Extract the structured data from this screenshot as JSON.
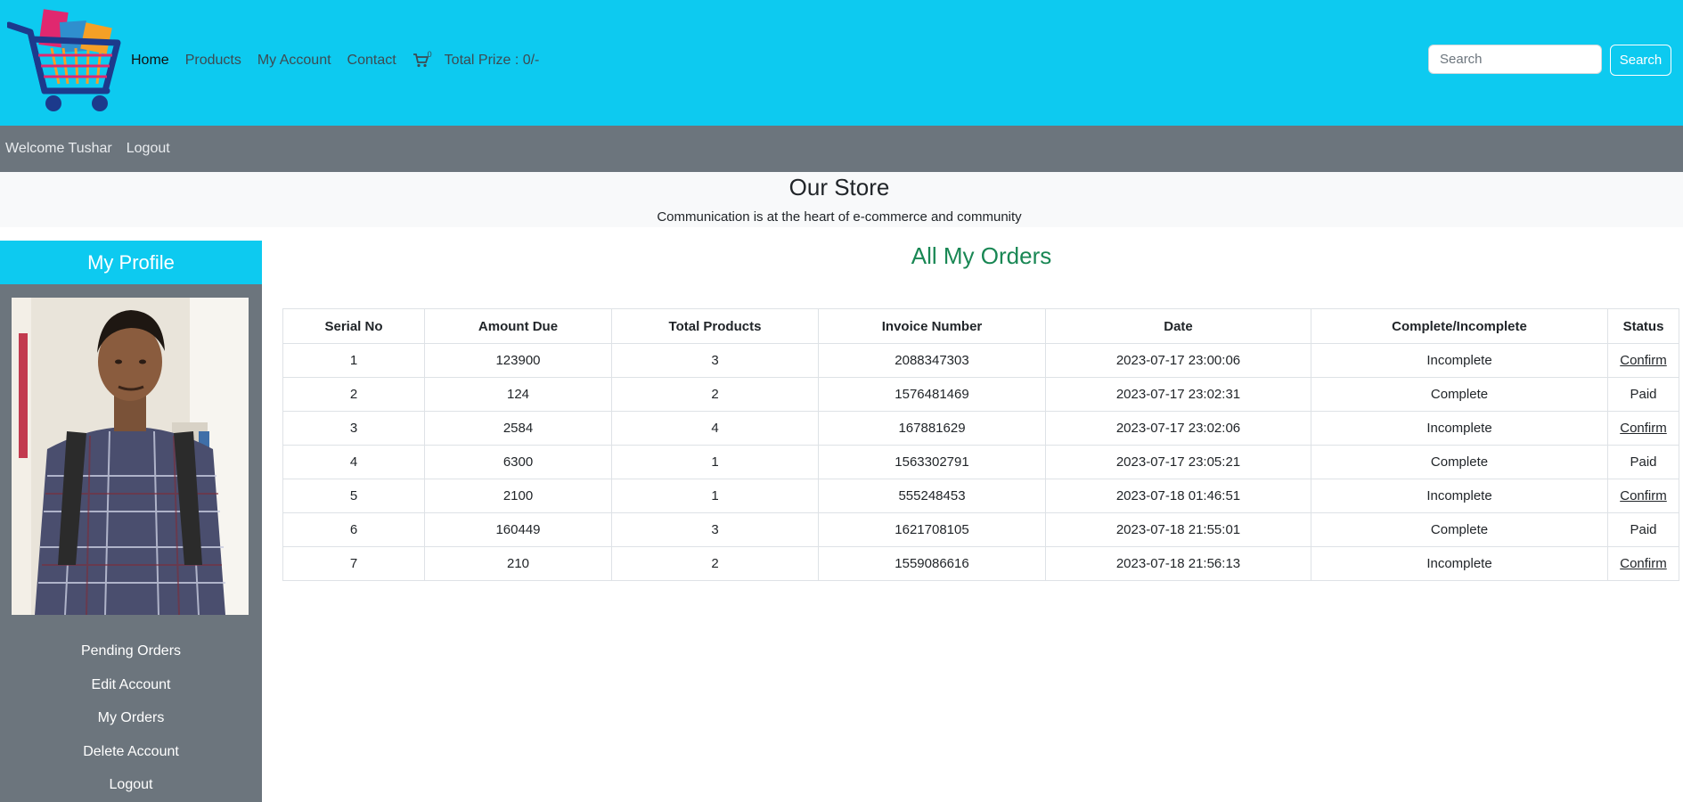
{
  "nav": {
    "links": [
      "Home",
      "Products",
      "My Account",
      "Contact"
    ],
    "cart_count": "0",
    "total_prize": "Total Prize : 0/-"
  },
  "search": {
    "placeholder": "Search",
    "button": "Search"
  },
  "userbar": {
    "welcome": "Welcome Tushar",
    "logout": "Logout"
  },
  "store": {
    "title": "Our Store",
    "tagline": "Communication is at the heart of e-commerce and community"
  },
  "sidebar": {
    "title": "My Profile",
    "links": [
      "Pending Orders",
      "Edit Account",
      "My Orders",
      "Delete Account",
      "Logout"
    ]
  },
  "orders": {
    "title": "All My Orders",
    "headers": [
      "Serial No",
      "Amount Due",
      "Total Products",
      "Invoice Number",
      "Date",
      "Complete/Incomplete",
      "Status"
    ],
    "rows": [
      [
        "1",
        "123900",
        "3",
        "2088347303",
        "2023-07-17 23:00:06",
        "Incomplete",
        "Confirm"
      ],
      [
        "2",
        "124",
        "2",
        "1576481469",
        "2023-07-17 23:02:31",
        "Complete",
        "Paid"
      ],
      [
        "3",
        "2584",
        "4",
        "167881629",
        "2023-07-17 23:02:06",
        "Incomplete",
        "Confirm"
      ],
      [
        "4",
        "6300",
        "1",
        "1563302791",
        "2023-07-17 23:05:21",
        "Complete",
        "Paid"
      ],
      [
        "5",
        "2100",
        "1",
        "555248453",
        "2023-07-18 01:46:51",
        "Incomplete",
        "Confirm"
      ],
      [
        "6",
        "160449",
        "3",
        "1621708105",
        "2023-07-18 21:55:01",
        "Complete",
        "Paid"
      ],
      [
        "7",
        "210",
        "2",
        "1559086616",
        "2023-07-18 21:56:13",
        "Incomplete",
        "Confirm"
      ]
    ]
  },
  "colors": {
    "navbar": "#0dcaf0",
    "secondbar": "#6c757d",
    "orders_title": "#198754"
  }
}
